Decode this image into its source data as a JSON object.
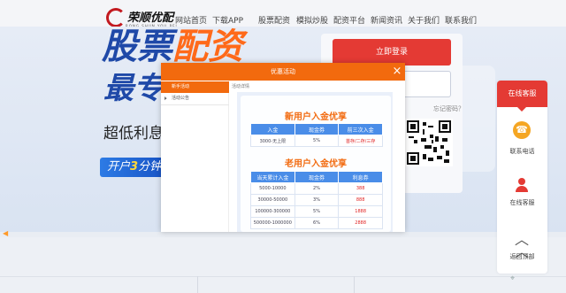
{
  "nav": {
    "logo_text": "荣顺优配",
    "logo_sub": "RONG SHUN YOU PEI",
    "items": [
      "网站首页",
      "下载APP",
      "股票配资",
      "模拟炒股",
      "配资平台",
      "新闻资讯",
      "关于我们",
      "联系我们"
    ]
  },
  "banner": {
    "headline_blue": "股票",
    "headline_orange": "配资",
    "headline2": "最专业",
    "subtitle": "超低利息 住",
    "pill_prefix": "开户",
    "pill_num": "3",
    "pill_suffix": "分钟"
  },
  "login": {
    "button_label": "立即登录",
    "help_link": "忘记密码？"
  },
  "side": {
    "top_label": "在线客服",
    "phone_label": "联系电话",
    "service_label": "在线客服",
    "top_label2": "返回顶部",
    "phone_icon": "phone-icon",
    "service_icon": "headset-icon"
  },
  "modal": {
    "title": "优惠活动",
    "close": "×",
    "menu": [
      {
        "label": "新手活动",
        "active": true
      },
      {
        "label": "活动公告",
        "active": false
      }
    ],
    "crumb": "活动详情",
    "promo1": {
      "title": "新用户入金优享",
      "headers": [
        "入金",
        "现金券",
        "前三次入金"
      ],
      "rows": [
        [
          "3000-无上限",
          "5%",
          "首存/二存/三存"
        ]
      ]
    },
    "promo2": {
      "title": "老用户入金优享",
      "headers": [
        "当天累计入金",
        "现金券",
        "利息券"
      ],
      "rows": [
        [
          "5000-10000",
          "2%",
          "388"
        ],
        [
          "30000-50000",
          "3%",
          "888"
        ],
        [
          "100000-300000",
          "5%",
          "1888"
        ],
        [
          "500000-1000000",
          "6%",
          "2888"
        ]
      ]
    }
  },
  "colors": {
    "accent_orange": "#f26a0e",
    "accent_red": "#e43a34",
    "table_blue": "#4a8de8"
  }
}
